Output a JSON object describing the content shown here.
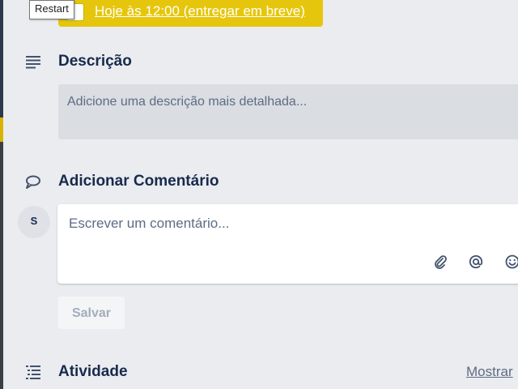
{
  "tooltip": {
    "text": "Restart"
  },
  "due_date": {
    "text": "Hoje às 12:00 (entregar em breve)"
  },
  "description": {
    "title": "Descrição",
    "placeholder": "Adicione uma descrição mais detalhada..."
  },
  "comment": {
    "title": "Adicionar Comentário",
    "avatar_initial": "S",
    "placeholder": "Escrever um comentário...",
    "save_label": "Salvar"
  },
  "activity": {
    "title": "Atividade",
    "show_link": "Mostrar"
  },
  "colors": {
    "background": "#ebecf0",
    "due_chip": "#e6c60d",
    "title_text": "#172b4d",
    "muted_text": "#5e6c84"
  }
}
